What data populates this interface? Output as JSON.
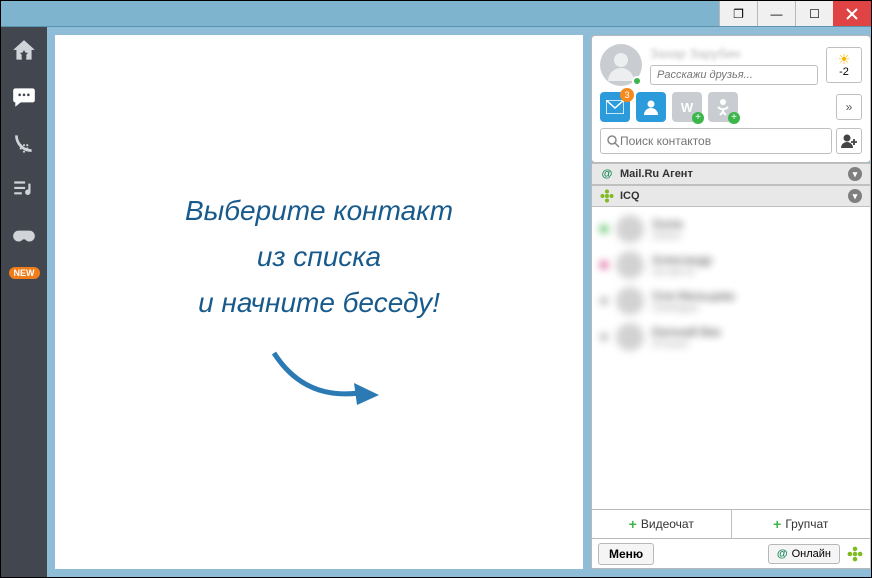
{
  "window": {
    "cascade_glyph": "❐"
  },
  "sidebar": {
    "new_badge": "NEW"
  },
  "canvas": {
    "line1": "Выберите контакт",
    "line2": "из списка",
    "line3": "и начните беседу!"
  },
  "profile": {
    "name_placeholder": "Захар Зарубин",
    "status_placeholder": "Расскажи друзья...",
    "weather_temp": "-2",
    "mail_badge": "3"
  },
  "search": {
    "placeholder": "Поиск контактов"
  },
  "groups": {
    "mailru": "Mail.Ru Агент",
    "icq": "ICQ"
  },
  "contacts": [
    {
      "name": "Sonia",
      "status": "Online",
      "dot": "green"
    },
    {
      "name": "Александр",
      "status": "На месте",
      "dot": "pink"
    },
    {
      "name": "Оля Мальцева",
      "status": "Свободна",
      "dot": "gray"
    },
    {
      "name": "Евгений Вик",
      "status": "Отошел",
      "dot": "gray"
    }
  ],
  "buttons": {
    "video": "Видеочат",
    "group": "Групчат",
    "menu": "Меню",
    "online": "Онлайн"
  }
}
